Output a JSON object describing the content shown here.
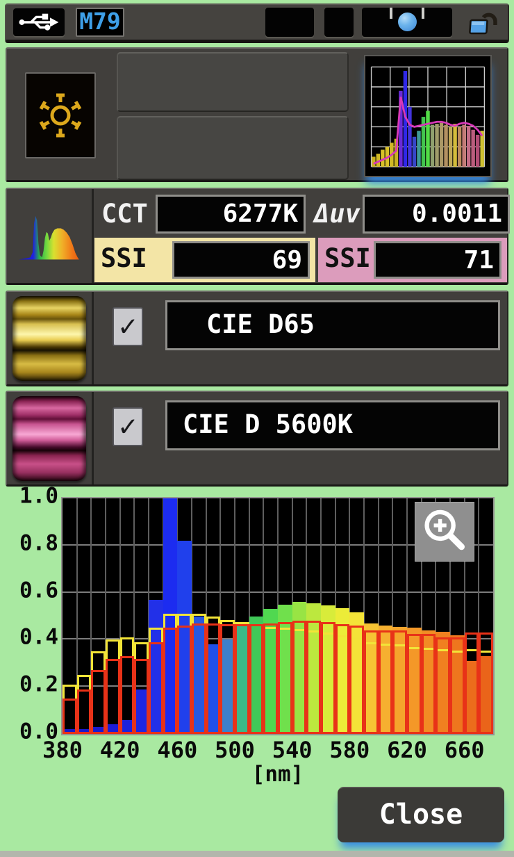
{
  "topbar": {
    "device_label": "M79"
  },
  "measurement": {
    "cct_label": "CCT",
    "cct_value": "6277K",
    "duv_label": "Δuv",
    "duv_value": "0.0011",
    "ssi1_label": "SSI",
    "ssi1_value": "69",
    "ssi2_label": "SSI",
    "ssi2_value": "71",
    "ssi1_color": "#f3e5a6",
    "ssi2_color": "#dc9cbc"
  },
  "references": [
    {
      "label": "CIE D65",
      "checked": true,
      "check_glyph": "✓"
    },
    {
      "label": "CIE D 5600K",
      "checked": true,
      "check_glyph": "✓"
    }
  ],
  "chart_data": {
    "type": "bar",
    "x": [
      380,
      390,
      400,
      410,
      420,
      430,
      440,
      450,
      460,
      470,
      480,
      490,
      500,
      510,
      520,
      530,
      540,
      550,
      560,
      570,
      580,
      590,
      600,
      610,
      620,
      630,
      640,
      650,
      660,
      670
    ],
    "x_step_nm": 10,
    "xlabel": "[nm]",
    "ylim": [
      0,
      1
    ],
    "yticks": [
      "1.0",
      "0.8",
      "0.6",
      "0.4",
      "0.2",
      "0.0"
    ],
    "xticks": [
      380,
      420,
      460,
      500,
      540,
      580,
      620,
      660
    ],
    "grid_y": [
      0.2,
      0.4,
      0.6,
      0.8
    ],
    "series": [
      {
        "name": "measured",
        "style": "fill",
        "values": [
          0.02,
          0.02,
          0.03,
          0.04,
          0.06,
          0.19,
          0.57,
          1.0,
          0.82,
          0.5,
          0.38,
          0.4,
          0.46,
          0.5,
          0.53,
          0.55,
          0.56,
          0.555,
          0.545,
          0.535,
          0.515,
          0.47,
          0.46,
          0.455,
          0.45,
          0.44,
          0.435,
          0.42,
          0.31,
          0.33
        ],
        "colors": [
          "#1818c8",
          "#1818cc",
          "#1a1ad0",
          "#1c1cd8",
          "#1e22dc",
          "#2026e0",
          "#2230e8",
          "#1c2cf0",
          "#2040ec",
          "#2858e0",
          "#2050e8",
          "#3c80cc",
          "#3cb888",
          "#40c858",
          "#50d850",
          "#70e04c",
          "#98e444",
          "#bce83e",
          "#d8ec3a",
          "#ecec38",
          "#f4e438",
          "#f6c434",
          "#f6b030",
          "#f5a42c",
          "#f49828",
          "#f28c24",
          "#f08020",
          "#ee761e",
          "#ec6c1c",
          "#ea641a"
        ]
      },
      {
        "name": "CIE D65",
        "style": "outline",
        "color": "#f2e438",
        "values": [
          0.21,
          0.25,
          0.35,
          0.4,
          0.41,
          0.39,
          0.45,
          0.51,
          0.51,
          0.51,
          0.5,
          0.485,
          0.475,
          0.465,
          0.455,
          0.45,
          0.445,
          0.44,
          0.43,
          0.42,
          0.41,
          0.39,
          0.385,
          0.38,
          0.37,
          0.365,
          0.36,
          0.355,
          0.36,
          0.355
        ]
      },
      {
        "name": "CIE D 5600K",
        "style": "outline",
        "color": "#e83218",
        "values": [
          0.15,
          0.19,
          0.27,
          0.32,
          0.33,
          0.32,
          0.39,
          0.45,
          0.46,
          0.47,
          0.47,
          0.465,
          0.465,
          0.465,
          0.47,
          0.475,
          0.48,
          0.48,
          0.475,
          0.465,
          0.46,
          0.44,
          0.44,
          0.44,
          0.425,
          0.425,
          0.41,
          0.41,
          0.43,
          0.43
        ]
      }
    ]
  },
  "mini_chart": {
    "type": "bar",
    "values": [
      0.1,
      0.13,
      0.17,
      0.2,
      0.24,
      0.28,
      0.76,
      0.96,
      0.6,
      0.3,
      0.36,
      0.5,
      0.56,
      0.42,
      0.43,
      0.44,
      0.42,
      0.4,
      0.43,
      0.4,
      0.42,
      0.41,
      0.37,
      0.32,
      0.36
    ],
    "colors": [
      "#c8b020",
      "#d0b824",
      "#d8c028",
      "#d8c028",
      "#d0b824",
      "#c8b020",
      "#6a2ad8",
      "#3028e8",
      "#4334dc",
      "#3646c8",
      "#3f9898",
      "#42c44e",
      "#52dc46",
      "#8fa06e",
      "#9f9c6a",
      "#ab9866",
      "#b39162",
      "#c0a857",
      "#d4bc3c",
      "#bd8b5e",
      "#c37a76",
      "#c36d86",
      "#bb5d7e",
      "#b14c74",
      "#cfc132"
    ],
    "outline_values": [
      0.03,
      0.05,
      0.07,
      0.09,
      0.12,
      0.16,
      0.7,
      0.5,
      0.42,
      0.4,
      0.41,
      0.42,
      0.43,
      0.44,
      0.45,
      0.45,
      0.44,
      0.42,
      0.41,
      0.43,
      0.44,
      0.43,
      0.41,
      0.37,
      0.31
    ],
    "outline_color": "#d838b8"
  },
  "close_label": "Close",
  "colors": {
    "background_green": "#a9e9a1",
    "panel_gray": "#413f3c",
    "d65_outline": "#f2e438",
    "d5600_outline": "#e83218",
    "m79_blue": "#3e9fe8"
  }
}
